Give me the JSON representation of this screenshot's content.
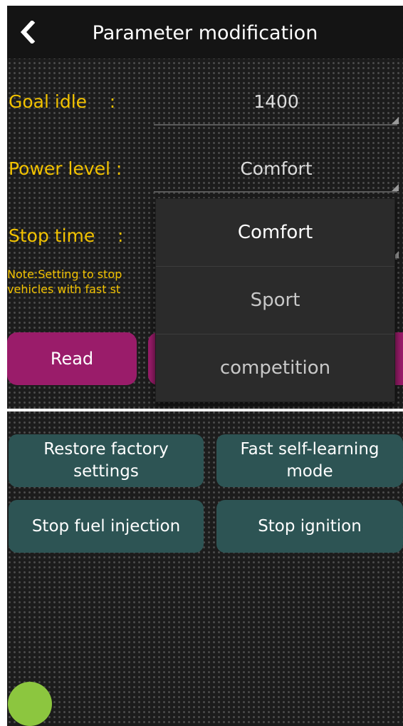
{
  "colors": {
    "label": "#f2c200",
    "action_button": "#9a1c6a",
    "tool_button": "#2d5454",
    "floating_button": "#8cc63f"
  },
  "header": {
    "back_icon": "chevron-left-icon",
    "title": "Parameter modification"
  },
  "params": {
    "goal_idle": {
      "label": "Goal idle    :",
      "value": "1400"
    },
    "power_level": {
      "label": "Power level :",
      "value": "Comfort"
    },
    "stop_time": {
      "label": "Stop time    :",
      "value": ""
    }
  },
  "note": {
    "line1": "Note:Setting to stop",
    "line2": "vehicles with fast st"
  },
  "actions": {
    "read_label": "Read"
  },
  "dropdown": {
    "options": [
      "Comfort",
      "Sport",
      "competition"
    ],
    "selected": "Comfort"
  },
  "tools": {
    "restore_line1": "Restore factory",
    "restore_line2": "settings",
    "fast_line1": "Fast self-learning",
    "fast_line2": "mode",
    "stop_fuel": "Stop fuel injection",
    "stop_ignition": "Stop ignition"
  }
}
